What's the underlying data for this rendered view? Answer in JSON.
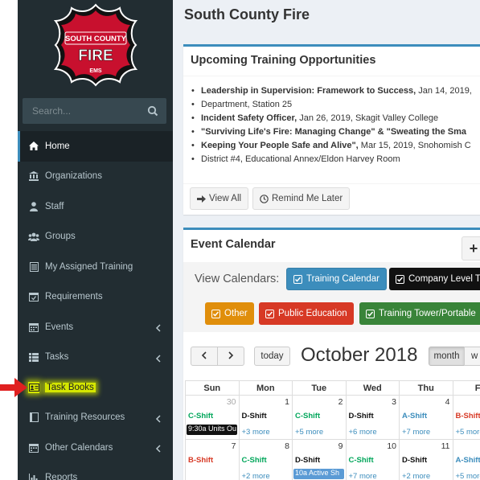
{
  "app": {
    "title": "South County Fire",
    "logo": {
      "line1": "SOUTH COUNTY",
      "line2": "FIRE",
      "line3": "EMS"
    }
  },
  "sidebar": {
    "search_placeholder": "Search...",
    "items": [
      {
        "label": "Home",
        "icon": "home-icon",
        "active": true
      },
      {
        "label": "Organizations",
        "icon": "bank-icon"
      },
      {
        "label": "Staff",
        "icon": "user-icon"
      },
      {
        "label": "Groups",
        "icon": "users-icon"
      },
      {
        "label": "My Assigned Training",
        "icon": "list-alt-icon"
      },
      {
        "label": "Requirements",
        "icon": "calendar-check-icon"
      },
      {
        "label": "Events",
        "icon": "calendar-icon",
        "has_children": true
      },
      {
        "label": "Tasks",
        "icon": "list-icon",
        "has_children": true
      },
      {
        "label": "Task Books",
        "icon": "address-card-icon",
        "highlighted": true
      },
      {
        "label": "Training Resources",
        "icon": "book-icon",
        "has_children": true
      },
      {
        "label": "Other Calendars",
        "icon": "calendar-icon",
        "has_children": true
      },
      {
        "label": "Reports",
        "icon": "bar-chart-icon"
      }
    ]
  },
  "training_box": {
    "title": "Upcoming Training Opportunities",
    "items": [
      {
        "line1_bold": "Leadership in Supervision: Framework to Success,",
        "line1_rest": " Jan 14, 2019,",
        "line2": "Department, Station 25"
      },
      {
        "line1_bold": "Incident Safety Officer,",
        "line1_rest": " Jan 26, 2019, Skagit Valley College",
        "line2": ""
      },
      {
        "line1_bold": "\"Surviving Life's Fire: Managing Change\" & \"Sweating the Sma",
        "line1_rest": "",
        "line2_bold": "Keeping Your People Safe and Alive\",",
        "line2": " Mar 15, 2019, Snohomish C",
        "line3": "District #4, Educational Annex/Eldon Harvey Room"
      }
    ],
    "view_all_label": "View All",
    "remind_label": "Remind Me Later"
  },
  "event_calendar": {
    "title": "Event Calendar",
    "plus_label": "+",
    "view_calendars_label": "View Calendars:",
    "filters": [
      {
        "label": "Training Calendar",
        "color": "#3c8dbc"
      },
      {
        "label": "Company Level Tr",
        "color": "#111111"
      },
      {
        "label": "Other",
        "color": "#e08e0b"
      },
      {
        "label": "Public Education",
        "color": "#d73925"
      },
      {
        "label": "Training Tower/Portable",
        "color": "#398439"
      }
    ],
    "today_label": "today",
    "month_title": "October 2018",
    "view_month_label": "month",
    "view_week_label": "w",
    "day_headers": [
      "Sun",
      "Mon",
      "Tue",
      "Wed",
      "Thu",
      "Fr"
    ],
    "weeks": [
      [
        {
          "day": "30",
          "other": true,
          "shift": "C-Shift",
          "shift_color": "#00a65a",
          "event": "9:30a Units Ou",
          "event_style": "black"
        },
        {
          "day": "1",
          "shift": "D-Shift",
          "shift_color": "#111111",
          "more": "+3 more"
        },
        {
          "day": "2",
          "shift": "C-Shift",
          "shift_color": "#00a65a",
          "more": "+5 more"
        },
        {
          "day": "3",
          "shift": "D-Shift",
          "shift_color": "#111111",
          "more": "+6 more"
        },
        {
          "day": "4",
          "shift": "A-Shift",
          "shift_color": "#3c8dbc",
          "more": "+7 more"
        },
        {
          "day": "",
          "shift": "B-Shift",
          "shift_color": "#d73925",
          "more": "+5 more"
        }
      ],
      [
        {
          "day": "7",
          "shift": "B-Shift",
          "shift_color": "#d73925"
        },
        {
          "day": "8",
          "shift": "C-Shift",
          "shift_color": "#00a65a",
          "more": "+2 more"
        },
        {
          "day": "9",
          "shift": "D-Shift",
          "shift_color": "#111111",
          "event": "10a Active Sh",
          "event_style": "blue"
        },
        {
          "day": "10",
          "shift": "C-Shift",
          "shift_color": "#00a65a",
          "more": "+7 more"
        },
        {
          "day": "11",
          "shift": "D-Shift",
          "shift_color": "#111111",
          "more": "+2 more"
        },
        {
          "day": "",
          "shift": "A-Shift",
          "shift_color": "#3c8dbc",
          "more": "+5 more"
        }
      ]
    ]
  }
}
